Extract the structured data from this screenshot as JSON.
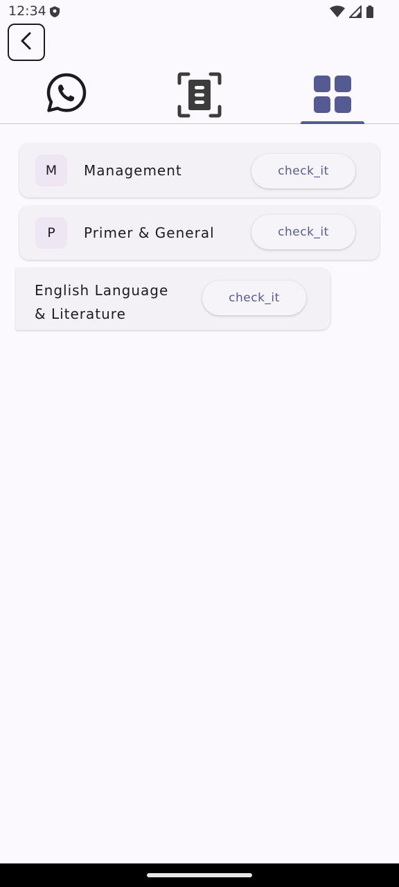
{
  "status_bar": {
    "time": "12:34"
  },
  "tabs": [
    {
      "icon": "whatsapp-icon"
    },
    {
      "icon": "document-scan-icon"
    },
    {
      "icon": "grid-icon",
      "selected": true
    }
  ],
  "colors": {
    "accent": "#565a92",
    "background": "#fbf8fe",
    "card": "#f3f0f6"
  },
  "items": [
    {
      "avatar": "M",
      "title": "Management",
      "button": "check_it"
    },
    {
      "avatar": "P",
      "title": "Primer & General",
      "button": "check_it"
    },
    {
      "title_line1": "English Language",
      "title_line2": "& Literature",
      "button": "check_it"
    }
  ]
}
